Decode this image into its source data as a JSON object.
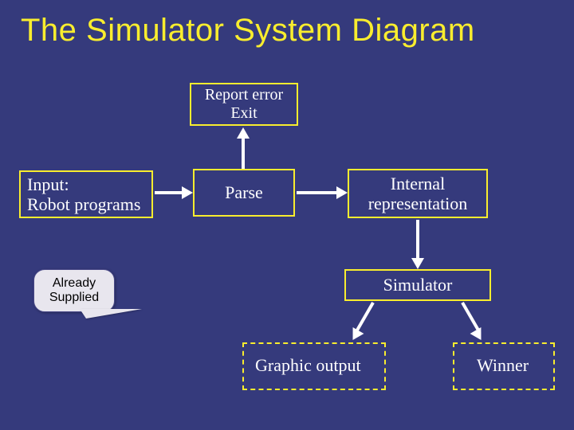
{
  "title": "The Simulator System Diagram",
  "nodes": {
    "report_error": {
      "line1": "Report error",
      "line2": "Exit"
    },
    "input": {
      "line1": "Input:",
      "line2": "Robot programs"
    },
    "parse": "Parse",
    "internal": {
      "line1": "Internal",
      "line2": "representation"
    },
    "simulator": "Simulator",
    "graphic": "Graphic output",
    "winner": "Winner"
  },
  "callout": {
    "line1": "Already",
    "line2": "Supplied"
  }
}
